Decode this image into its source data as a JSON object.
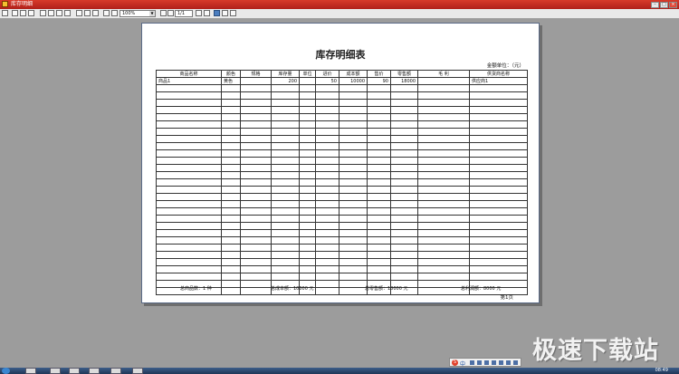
{
  "window": {
    "title": "库存明细"
  },
  "toolbar": {
    "zoom": "100%",
    "page": "1/1"
  },
  "report": {
    "title": "库存明细表",
    "unit": "金额单位：（元）",
    "columns": [
      "商品名称",
      "颜色",
      "规格",
      "库存量",
      "单位",
      "进价",
      "成本额",
      "售价",
      "零售额",
      "毛 利",
      "供货商名称"
    ],
    "rows": [
      [
        "商品1",
        "黄色",
        "",
        "200",
        "",
        "50",
        "10000",
        "90",
        "18000",
        "",
        "供应商1"
      ]
    ],
    "empty_rows": 29,
    "totals": {
      "count": "总商品数：1 种",
      "cost": "总成本额：10000 元",
      "retail": "总零售额：18000 元",
      "profit": "总利润额：8000 元"
    },
    "page_label": "第1页"
  },
  "watermark": "极速下载站",
  "ime": {
    "label": "中"
  },
  "taskbar": {
    "clock": "08:49"
  }
}
